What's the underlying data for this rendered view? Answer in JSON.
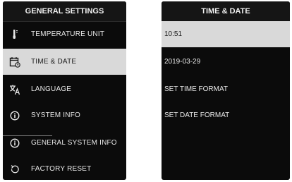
{
  "left_menu": {
    "title": "GENERAL SETTINGS",
    "items": [
      {
        "label": "TEMPERATURE UNIT",
        "icon": "thermometer-icon"
      },
      {
        "label": "TIME & DATE",
        "icon": "calendar-clock-icon",
        "selected": true
      },
      {
        "label": "LANGUAGE",
        "icon": "translate-icon"
      },
      {
        "label": "SYSTEM INFO",
        "icon": "info-icon"
      },
      {
        "label": "GENERAL SYSTEM INFO",
        "icon": "info-icon"
      },
      {
        "label": "FACTORY RESET",
        "icon": "reset-icon"
      }
    ]
  },
  "right_menu": {
    "title": "TIME & DATE",
    "items": [
      {
        "label": "10:51",
        "selected": true
      },
      {
        "label": "2019-03-29"
      },
      {
        "label": "SET TIME FORMAT"
      },
      {
        "label": "SET DATE FORMAT"
      }
    ]
  },
  "colors": {
    "panel_bg": "#0b0b0b",
    "selected_bg": "#d9d9d9",
    "text": "#e8e8e8"
  }
}
